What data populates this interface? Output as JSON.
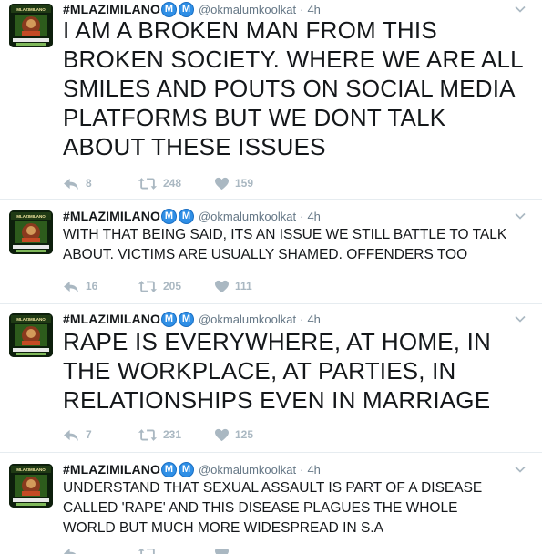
{
  "tweets": [
    {
      "display_name": "#MLAZIMILANO",
      "badge_letter": "M",
      "handle": "@okmalumkoolkat",
      "separator": "·",
      "time": "4h",
      "text": "I AM A BROKEN MAN FROM THIS BROKEN SOCIETY. WHERE WE ARE ALL SMILES AND POUTS ON SOCIAL MEDIA PLATFORMS BUT WE DONT TALK ABOUT THESE ISSUES",
      "replies": "8",
      "retweets": "248",
      "likes": "159"
    },
    {
      "display_name": "#MLAZIMILANO",
      "badge_letter": "M",
      "handle": "@okmalumkoolkat",
      "separator": "·",
      "time": "4h",
      "text": "WITH THAT BEING SAID, ITS AN ISSUE WE STILL BATTLE TO TALK ABOUT. VICTIMS ARE USUALLY SHAMED. OFFENDERS TOO",
      "replies": "16",
      "retweets": "205",
      "likes": "111"
    },
    {
      "display_name": "#MLAZIMILANO",
      "badge_letter": "M",
      "handle": "@okmalumkoolkat",
      "separator": "·",
      "time": "4h",
      "text": "RAPE IS EVERYWHERE, AT HOME, IN THE WORKPLACE, AT PARTIES, IN RELATIONSHIPS EVEN IN MARRIAGE",
      "replies": "7",
      "retweets": "231",
      "likes": "125"
    },
    {
      "display_name": "#MLAZIMILANO",
      "badge_letter": "M",
      "handle": "@okmalumkoolkat",
      "separator": "·",
      "time": "4h",
      "text": "UNDERSTAND THAT SEXUAL ASSAULT IS PART OF A DISEASE CALLED 'RAPE' AND THIS DISEASE PLAGUES THE WHOLE WORLD BUT MUCH MORE WIDESPREAD IN S.A"
    }
  ],
  "colors": {
    "action_gray": "#aab8c2",
    "meta_gray": "#657786",
    "badge_blue": "#2f8fe6",
    "divider": "#e6ecf0"
  },
  "icons": [
    "reply-icon",
    "retweet-icon",
    "heart-icon",
    "chevron-down-icon"
  ]
}
